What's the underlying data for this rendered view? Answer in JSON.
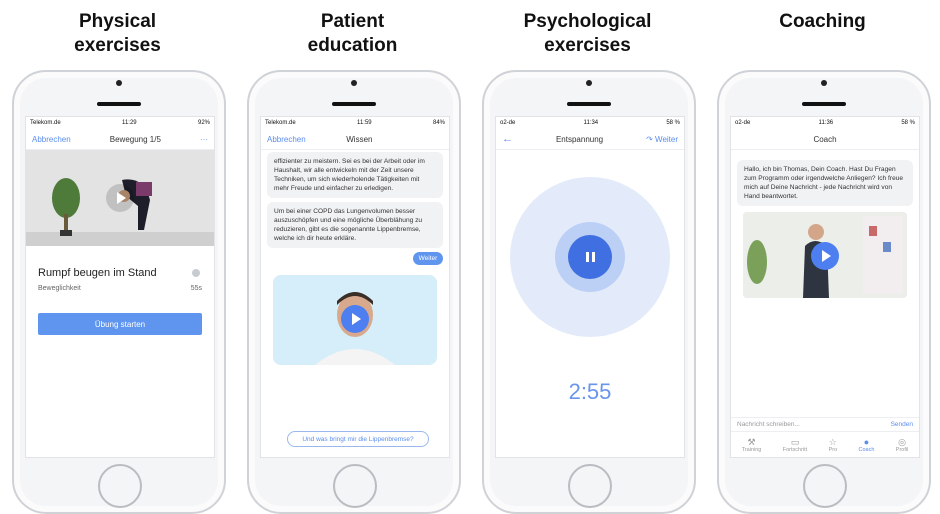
{
  "panels": [
    {
      "caption": "Physical\nexercises",
      "status": {
        "carrier": "Telekom.de",
        "time": "11:29",
        "battery": "92%"
      },
      "nav": {
        "left": "Abbrechen",
        "title": "Bewegung 1/5",
        "right": "···"
      },
      "exercise": {
        "title": "Rumpf beugen im Stand",
        "category": "Beweglichkeit",
        "duration": "55s",
        "start_label": "Übung starten"
      }
    },
    {
      "caption": "Patient\neducation",
      "status": {
        "carrier": "Telekom.de",
        "time": "11:59",
        "battery": "84%"
      },
      "nav": {
        "left": "Abbrechen",
        "title": "Wissen"
      },
      "messages": [
        "effizienter zu meistern. Sei es bei der Arbeit oder im Haushalt, wir alle entwickeln mit der Zeit unsere Techniken, um sich wiederholende Tätigkeiten mit mehr Freude und einfacher zu erledigen.",
        "Um bei einer COPD das Lungenvolumen besser auszuschöpfen und eine mögliche Überblähung zu reduzieren, gibt es die sogenannte Lippenbremse, welche ich dir heute erkläre."
      ],
      "continue_label": "Weiter",
      "reply_label": "Und was bringt mir die Lippenbremse?"
    },
    {
      "caption": "Psychological\nexercises",
      "status": {
        "carrier": "o2-de",
        "time": "11:34",
        "battery": "58 %"
      },
      "nav": {
        "title": "Entspannung",
        "right": "Weiter"
      },
      "timer": "2:55"
    },
    {
      "caption": "Coaching",
      "status": {
        "carrier": "o2-de",
        "time": "11:36",
        "battery": "58 %"
      },
      "nav": {
        "title": "Coach"
      },
      "message": "Hallo, ich bin Thomas, Dein Coach. Hast Du Fragen zum Programm oder irgendwelche Anliegen? Ich freue mich auf Deine Nachricht - jede Nachricht wird von Hand beantwortet.",
      "input_placeholder": "Nachricht schreiben...",
      "send_label": "Senden",
      "tabs": [
        {
          "label": "Training",
          "icon": "dumbbell-icon"
        },
        {
          "label": "Fortschritt",
          "icon": "book-icon"
        },
        {
          "label": "Pro",
          "icon": "star-icon"
        },
        {
          "label": "Coach",
          "icon": "coach-icon"
        },
        {
          "label": "Profil",
          "icon": "profile-icon"
        }
      ]
    }
  ],
  "colors": {
    "accent": "#5f95ee",
    "play": "#3f6fe0"
  }
}
